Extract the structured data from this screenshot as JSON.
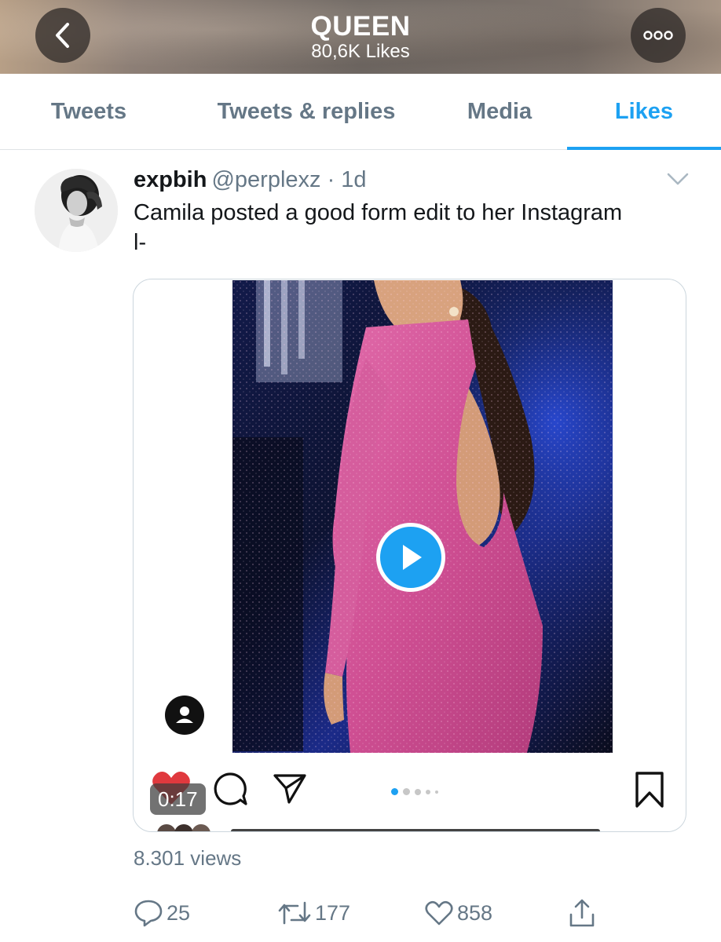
{
  "header": {
    "title": "QUEEN",
    "subtitle": "80,6K Likes",
    "back_icon": "chevron-left-icon",
    "more_icon": "more-horizontal-icon"
  },
  "tabs": [
    {
      "label": "Tweets",
      "active": false
    },
    {
      "label": "Tweets & replies",
      "active": false
    },
    {
      "label": "Media",
      "active": false
    },
    {
      "label": "Likes",
      "active": true
    }
  ],
  "tweet": {
    "name": "expbih",
    "handle_time": "@perplexz · 1d",
    "text": "Camila posted a good form edit to her Instagram\nl-",
    "media": {
      "duration": "0:17",
      "carousel_dots": 5,
      "carousel_active": 0
    },
    "views": "8.301 views",
    "actions": {
      "replies": "25",
      "retweets": "177",
      "likes": "858"
    }
  },
  "colors": {
    "accent": "#1da1f2",
    "muted": "#657786",
    "text": "#14171a"
  }
}
